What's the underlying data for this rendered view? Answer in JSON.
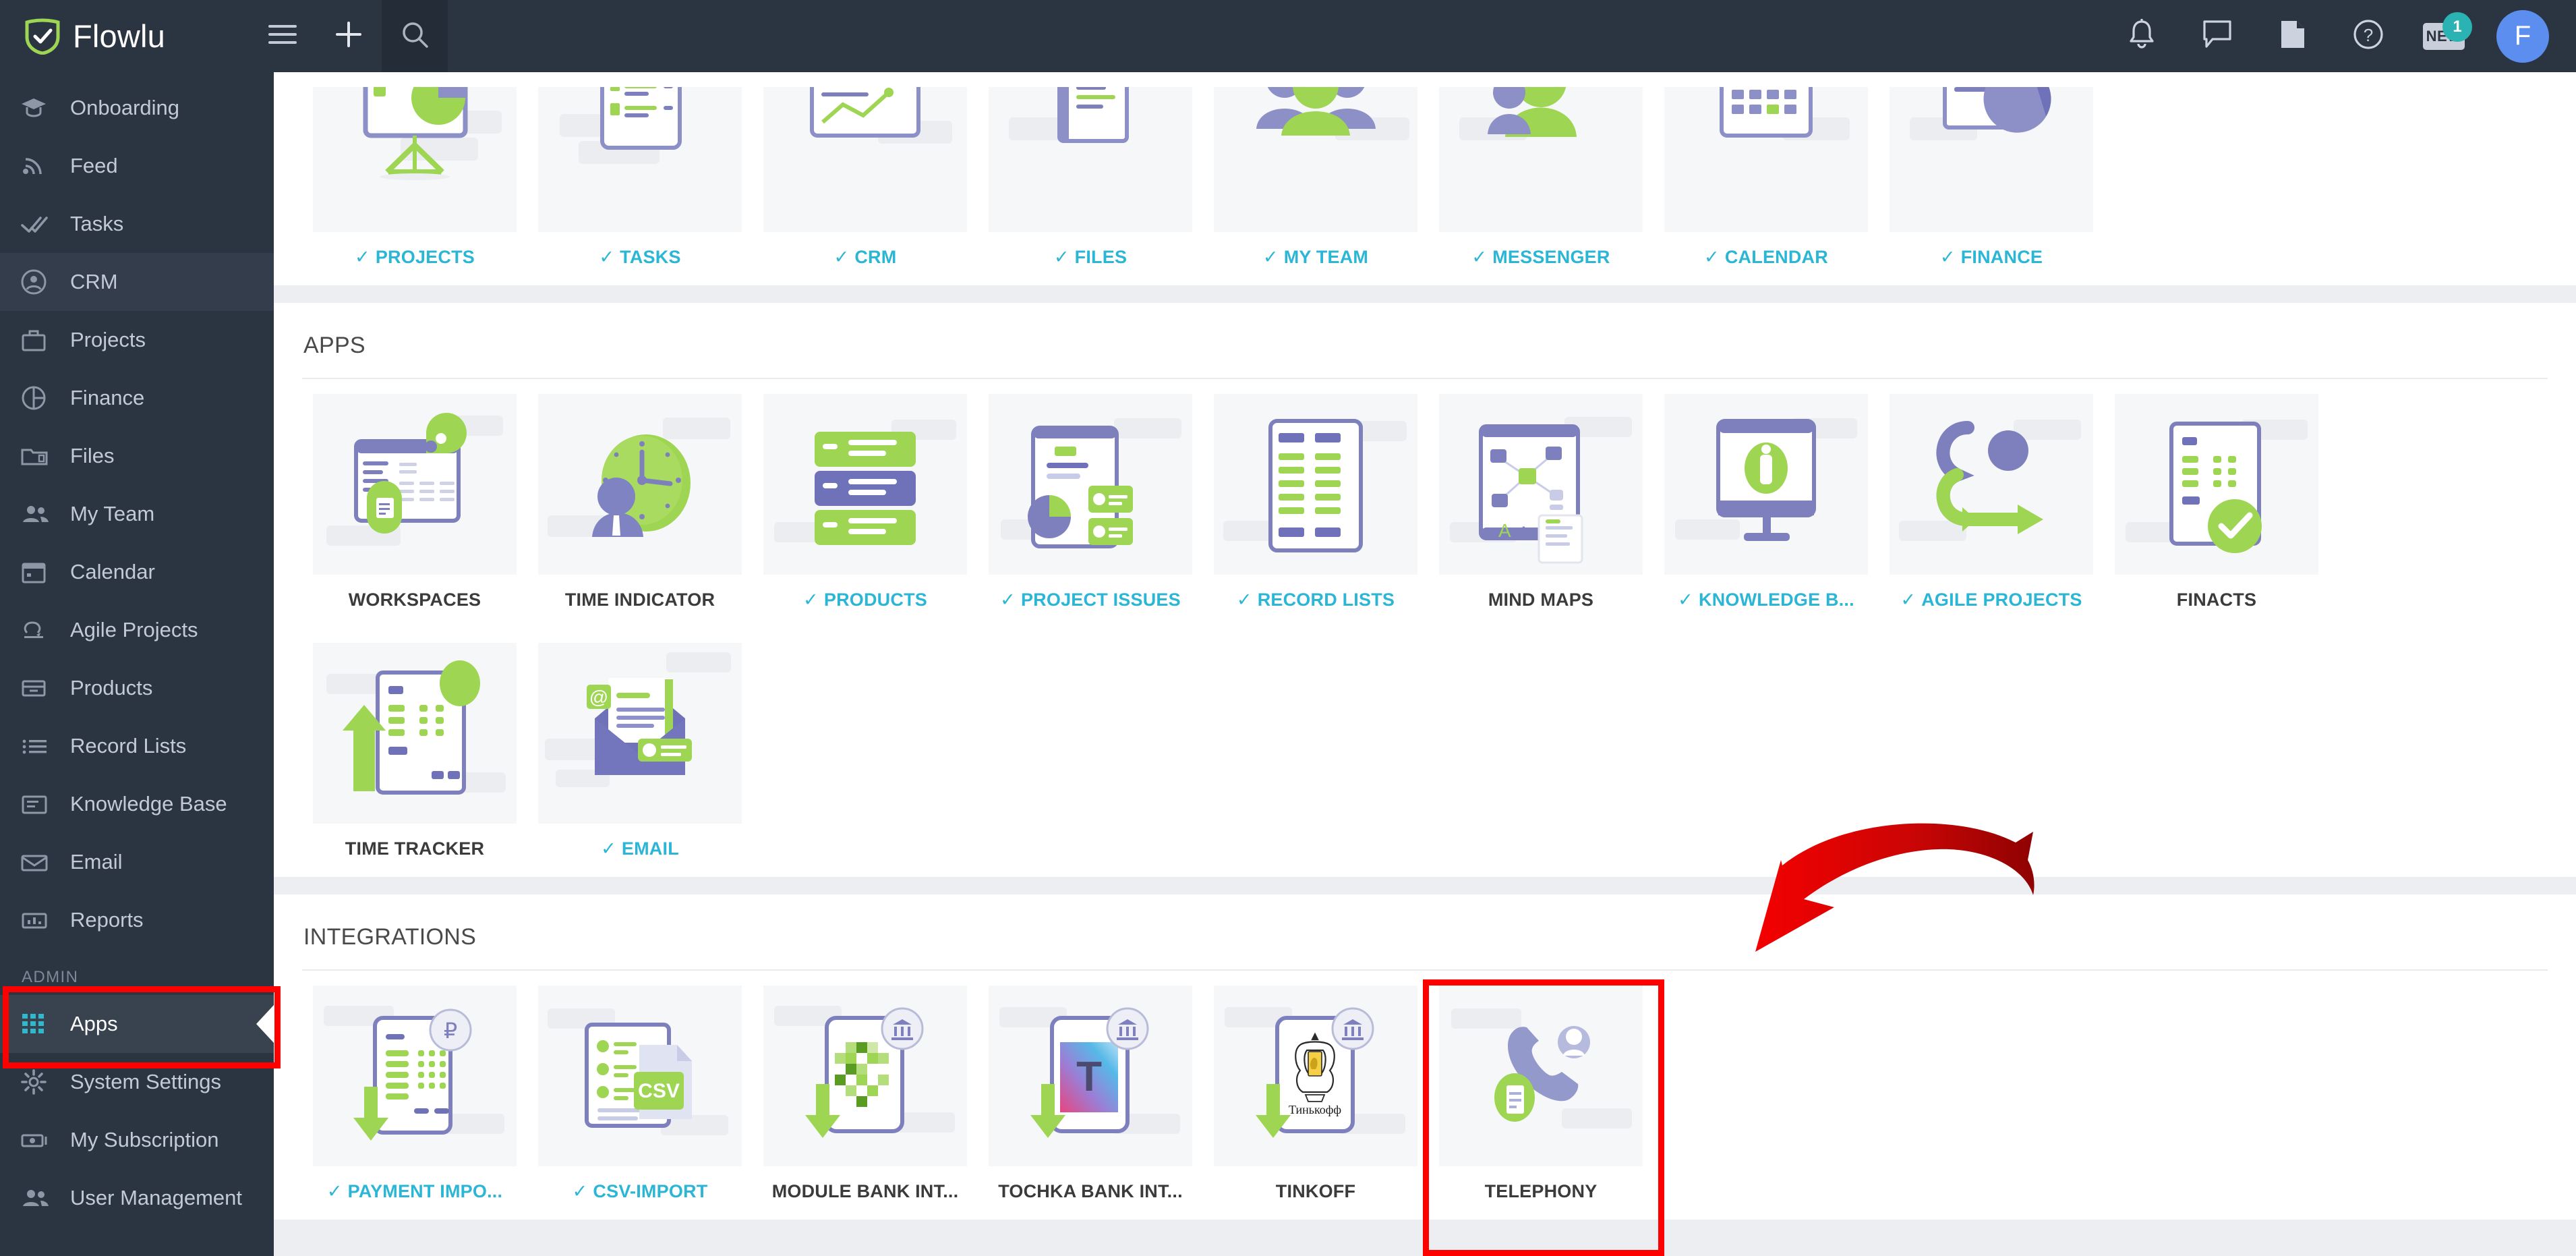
{
  "app": {
    "brand": "Flowlu"
  },
  "topbar": {
    "menu_icon": "hamburger-icon",
    "add_icon": "plus-icon",
    "search_icon": "search-icon",
    "notifications_icon": "bell-icon",
    "messages_icon": "chat-icon",
    "docs_icon": "document-icon",
    "help_icon": "help-circle-icon",
    "new_label": "NEW",
    "new_badge_count": "1",
    "avatar_initial": "F"
  },
  "sidebar": {
    "items": [
      {
        "label": "Onboarding",
        "icon": "graduation-cap-icon"
      },
      {
        "label": "Feed",
        "icon": "rss-icon"
      },
      {
        "label": "Tasks",
        "icon": "double-check-icon"
      },
      {
        "label": "CRM",
        "icon": "user-circle-icon"
      },
      {
        "label": "Projects",
        "icon": "briefcase-icon"
      },
      {
        "label": "Finance",
        "icon": "pie-chart-icon"
      },
      {
        "label": "Files",
        "icon": "folder-icon"
      },
      {
        "label": "My Team",
        "icon": "people-icon"
      },
      {
        "label": "Calendar",
        "icon": "calendar-icon"
      },
      {
        "label": "Agile Projects",
        "icon": "agile-loop-icon"
      },
      {
        "label": "Products",
        "icon": "box-icon"
      },
      {
        "label": "Record Lists",
        "icon": "list-icon"
      },
      {
        "label": "Knowledge Base",
        "icon": "book-icon"
      },
      {
        "label": "Email",
        "icon": "envelope-icon"
      },
      {
        "label": "Reports",
        "icon": "bar-chart-icon"
      }
    ],
    "admin_group_label": "ADMIN",
    "admin_items": [
      {
        "label": "Apps",
        "icon": "grid-apps-icon",
        "active": true
      },
      {
        "label": "System Settings",
        "icon": "gear-icon",
        "active": false
      },
      {
        "label": "My Subscription",
        "icon": "banknote-icon",
        "active": false
      },
      {
        "label": "User Management",
        "icon": "users-icon",
        "active": false
      }
    ]
  },
  "main": {
    "modules_section": {
      "tiles": [
        {
          "label": "PROJECTS",
          "enabled": true
        },
        {
          "label": "TASKS",
          "enabled": true
        },
        {
          "label": "CRM",
          "enabled": true
        },
        {
          "label": "FILES",
          "enabled": true
        },
        {
          "label": "MY TEAM",
          "enabled": true
        },
        {
          "label": "MESSENGER",
          "enabled": true
        },
        {
          "label": "CALENDAR",
          "enabled": true
        },
        {
          "label": "FINANCE",
          "enabled": true
        }
      ]
    },
    "apps_section": {
      "title": "APPS",
      "tiles": [
        {
          "label": "WORKSPACES",
          "enabled": false
        },
        {
          "label": "TIME INDICATOR",
          "enabled": false
        },
        {
          "label": "PRODUCTS",
          "enabled": true
        },
        {
          "label": "PROJECT ISSUES",
          "enabled": true
        },
        {
          "label": "RECORD LISTS",
          "enabled": true
        },
        {
          "label": "MIND MAPS",
          "enabled": false
        },
        {
          "label": "KNOWLEDGE B...",
          "enabled": true
        },
        {
          "label": "AGILE PROJECTS",
          "enabled": true
        },
        {
          "label": "FINACTS",
          "enabled": false
        },
        {
          "label": "TIME TRACKER",
          "enabled": false
        },
        {
          "label": "EMAIL",
          "enabled": true
        }
      ]
    },
    "integrations_section": {
      "title": "INTEGRATIONS",
      "tiles": [
        {
          "label": "PAYMENT IMPO...",
          "enabled": true
        },
        {
          "label": "CSV-IMPORT",
          "enabled": true
        },
        {
          "label": "MODULE BANK INT...",
          "enabled": false
        },
        {
          "label": "TOCHKA BANK INT...",
          "enabled": false
        },
        {
          "label": "TINKOFF",
          "enabled": false
        },
        {
          "label": "TELEPHONY",
          "enabled": false
        }
      ]
    }
  },
  "annotations": {
    "color": "#fd0000",
    "highlight_sidebar_item": "Apps",
    "highlight_tile": "TELEPHONY",
    "arrow": "curved-red-arrow-pointing-to-telephony"
  },
  "colors": {
    "accent_cyan": "#2bb6d6",
    "brand_green": "#9ed553",
    "sidebar_bg": "#2b3441",
    "page_bg": "#eceef2",
    "avatar_blue": "#5c8ef0",
    "badge_teal": "#2bb3b3",
    "annotation_red": "#fd0000"
  }
}
